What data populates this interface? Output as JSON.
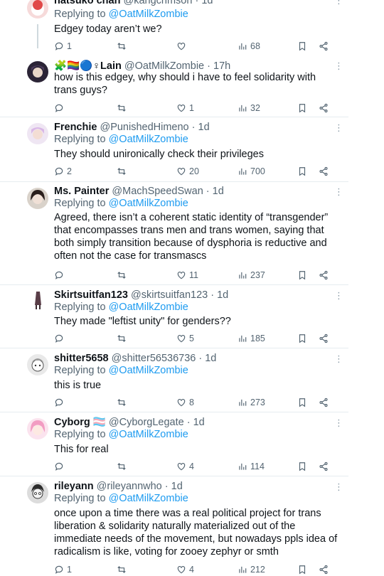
{
  "replying_label": "Replying to",
  "tweets": [
    {
      "name": "natsuko chan",
      "handle": "@kangcrimson",
      "time": "1d",
      "reply_to": "@OatMilkZombie",
      "text": "Edgey today aren’t we?",
      "replies": "1",
      "retweets": "",
      "likes": "",
      "views": "68"
    },
    {
      "name": "🧩🏳️‍🌈🔵♀Lain",
      "handle": "@OatMilkZombie",
      "time": "17h",
      "reply_to": "",
      "text": "how is this edgey, why should i have to feel solidarity with trans guys?",
      "replies": "",
      "retweets": "",
      "likes": "1",
      "views": "32"
    },
    {
      "name": "Frenchie",
      "handle": "@PunishedHimeno",
      "time": "1d",
      "reply_to": "@OatMilkZombie",
      "text": "They should unironically check their privileges",
      "replies": "2",
      "retweets": "",
      "likes": "20",
      "views": "700"
    },
    {
      "name": "Ms. Painter",
      "handle": "@MachSpeedSwan",
      "time": "1d",
      "reply_to": "@OatMilkZombie",
      "text": "Agreed, there isn’t a coherent static identity of “transgender” that encompasses trans men and trans women, saying that both simply transition because of dysphoria is reductive and often not the case for transmascs",
      "replies": "",
      "retweets": "",
      "likes": "11",
      "views": "237"
    },
    {
      "name": "Skirtsuitfan123",
      "handle": "@skirtsuitfan123",
      "time": "1d",
      "reply_to": "@OatMilkZombie",
      "text": "They made \"leftist unity\" for genders??",
      "replies": "",
      "retweets": "",
      "likes": "5",
      "views": "185"
    },
    {
      "name": "shitter5658",
      "handle": "@shitter56536736",
      "time": "1d",
      "reply_to": "@OatMilkZombie",
      "text": "this is true",
      "replies": "",
      "retweets": "",
      "likes": "8",
      "views": "273"
    },
    {
      "name": "Cyborg 🏳️‍⚧️",
      "handle": "@CyborgLegate",
      "time": "1d",
      "reply_to": "@OatMilkZombie",
      "text": "This for real",
      "replies": "",
      "retweets": "",
      "likes": "4",
      "views": "114"
    },
    {
      "name": "rileyann",
      "handle": "@rileyannwho",
      "time": "1d",
      "reply_to": "@OatMilkZombie",
      "text": "once upon a time there was a real political project for trans liberation & solidarity naturally materialized out of the immediate needs of the movement, but nowadays ppls idea of radicalism is like, voting for zooey zephyr or smth",
      "replies": "1",
      "retweets": "",
      "likes": "4",
      "views": "212"
    }
  ],
  "colors": {
    "link": "#1d9bf0",
    "muted": "#536471",
    "text": "#0f1419",
    "divider": "#e6ecf0"
  },
  "icons": [
    "reply-icon",
    "retweet-icon",
    "like-icon",
    "views-icon",
    "bookmark-icon",
    "share-icon",
    "more-icon"
  ]
}
